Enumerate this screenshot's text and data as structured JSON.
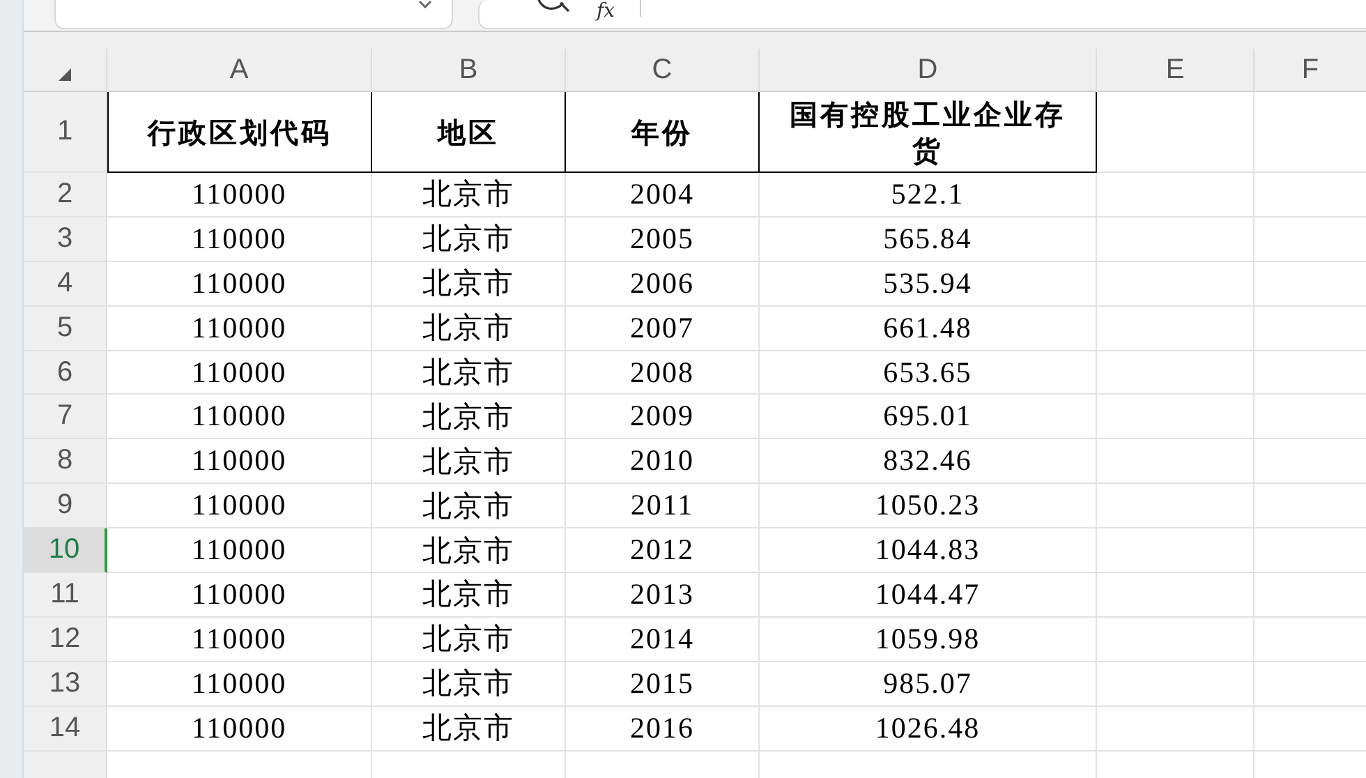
{
  "formula_bar": {
    "function_label": "fx"
  },
  "columns": [
    "A",
    "B",
    "C",
    "D",
    "E",
    "F"
  ],
  "header_row": {
    "number": "1",
    "cells": [
      "行政区划代码",
      "地区",
      "年份",
      "国有控股工业企业存货"
    ]
  },
  "rows": [
    {
      "number": "2",
      "selected": false,
      "cells": [
        "110000",
        "北京市",
        "2004",
        "522.1"
      ]
    },
    {
      "number": "3",
      "selected": false,
      "cells": [
        "110000",
        "北京市",
        "2005",
        "565.84"
      ]
    },
    {
      "number": "4",
      "selected": false,
      "cells": [
        "110000",
        "北京市",
        "2006",
        "535.94"
      ]
    },
    {
      "number": "5",
      "selected": false,
      "cells": [
        "110000",
        "北京市",
        "2007",
        "661.48"
      ]
    },
    {
      "number": "6",
      "selected": false,
      "cells": [
        "110000",
        "北京市",
        "2008",
        "653.65"
      ]
    },
    {
      "number": "7",
      "selected": false,
      "cells": [
        "110000",
        "北京市",
        "2009",
        "695.01"
      ]
    },
    {
      "number": "8",
      "selected": false,
      "cells": [
        "110000",
        "北京市",
        "2010",
        "832.46"
      ]
    },
    {
      "number": "9",
      "selected": false,
      "cells": [
        "110000",
        "北京市",
        "2011",
        "1050.23"
      ]
    },
    {
      "number": "10",
      "selected": true,
      "cells": [
        "110000",
        "北京市",
        "2012",
        "1044.83"
      ]
    },
    {
      "number": "11",
      "selected": false,
      "cells": [
        "110000",
        "北京市",
        "2013",
        "1044.47"
      ]
    },
    {
      "number": "12",
      "selected": false,
      "cells": [
        "110000",
        "北京市",
        "2014",
        "1059.98"
      ]
    },
    {
      "number": "13",
      "selected": false,
      "cells": [
        "110000",
        "北京市",
        "2015",
        "985.07"
      ]
    },
    {
      "number": "14",
      "selected": false,
      "cells": [
        "110000",
        "北京市",
        "2016",
        "1026.48"
      ]
    }
  ]
}
